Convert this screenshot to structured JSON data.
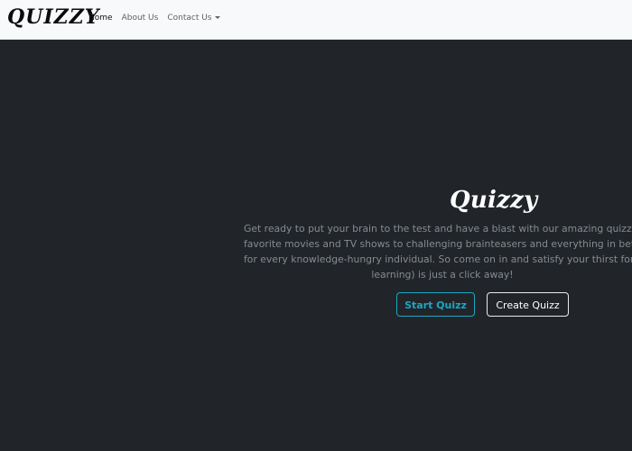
{
  "navbar": {
    "brand": "QUIZZY",
    "links": [
      {
        "label": "Home",
        "active": true
      },
      {
        "label": "About Us",
        "active": false
      },
      {
        "label": "Contact Us",
        "active": false,
        "dropdown": true
      }
    ]
  },
  "hero": {
    "title": "Quizzy",
    "text_lines": [
      "Get ready to put your brain to the test and have a blast with our amazing quizzes! Fr",
      "favorite movies and TV shows to challenging brainteasers and everything in between, ",
      "for every knowledge-hungry individual. So come on in and satisfy your thirst for triv",
      "learning) is just a click away!"
    ],
    "buttons": {
      "start_label": "Start Quizz",
      "create_label": "Create Quizz"
    }
  },
  "colors": {
    "background": "#212529",
    "navbar": "#f8f9fa",
    "accent": "#19a7c4"
  }
}
